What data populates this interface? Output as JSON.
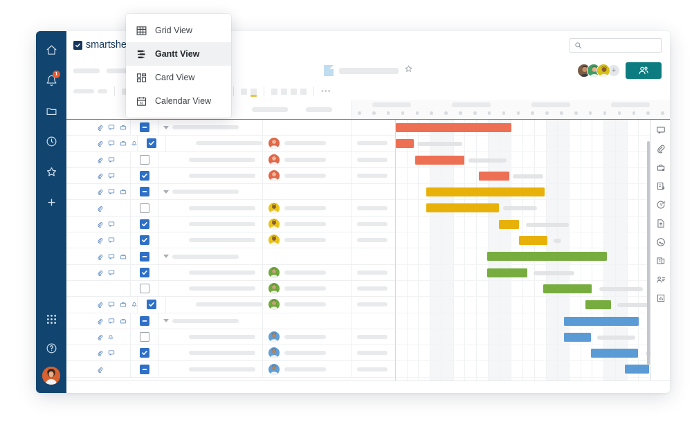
{
  "app": {
    "name": "smartsheet",
    "logo_icon": "checkbox-mark-icon"
  },
  "left_rail": {
    "items": [
      {
        "icon": "home-icon",
        "name": "home",
        "badge": null
      },
      {
        "icon": "bell-icon",
        "name": "notifications",
        "badge": "1"
      },
      {
        "icon": "folder-icon",
        "name": "browse",
        "badge": null
      },
      {
        "icon": "clock-icon",
        "name": "recents",
        "badge": null
      },
      {
        "icon": "star-icon",
        "name": "favorites",
        "badge": null
      },
      {
        "icon": "plus-icon",
        "name": "create",
        "badge": null
      }
    ],
    "bottom_items": [
      {
        "icon": "grid-apps-icon",
        "name": "apps-launcher"
      },
      {
        "icon": "help-icon",
        "name": "help"
      },
      {
        "icon": "user-avatar",
        "name": "account-avatar"
      }
    ]
  },
  "header": {
    "search_placeholder": "",
    "search_value": "",
    "search_icon": "search-icon",
    "share_icon": "share-people-icon",
    "share_label": "",
    "avatar_overflow_label": "+",
    "avatars": [
      {
        "name": "collaborator-1",
        "color": "#7a5c45"
      },
      {
        "name": "collaborator-2",
        "color": "#3f9e63"
      },
      {
        "name": "collaborator-3",
        "color": "#d8c117"
      }
    ]
  },
  "title_row": {
    "sheet_icon": "sheet-document-icon",
    "sheet_title": "",
    "favorite_icon": "star-outline-icon"
  },
  "toolbar": {
    "overflow_icon": "more-horizontal-icon",
    "highlight_colors": {
      "cyan": "#35c5d8",
      "black": "#1d1d1d",
      "yellow": "#e8c548"
    }
  },
  "view_menu": {
    "items": [
      {
        "label": "Grid View",
        "icon": "grid-view-icon",
        "active": false
      },
      {
        "label": "Gantt View",
        "icon": "gantt-view-icon",
        "active": true
      },
      {
        "label": "Card View",
        "icon": "card-view-icon",
        "active": false
      },
      {
        "label": "Calendar View",
        "icon": "calendar-view-icon",
        "active": false
      }
    ]
  },
  "right_rail": {
    "items": [
      {
        "icon": "conversations-icon",
        "name": "conversations"
      },
      {
        "icon": "attachments-icon",
        "name": "attachments"
      },
      {
        "icon": "proofs-icon",
        "name": "proofs"
      },
      {
        "icon": "update-request-icon",
        "name": "update-requests"
      },
      {
        "icon": "activity-log-icon",
        "name": "activity-log"
      },
      {
        "icon": "publish-icon",
        "name": "publish"
      },
      {
        "icon": "automation-icon",
        "name": "automation"
      },
      {
        "icon": "summary-icon",
        "name": "sheet-summary"
      },
      {
        "icon": "contacts-icon",
        "name": "contacts"
      },
      {
        "icon": "reports-icon",
        "name": "reports"
      }
    ]
  },
  "chart_data": {
    "type": "gantt",
    "title": "",
    "colors": {
      "group_1": "#ed7054",
      "group_2": "#e8b109",
      "group_3": "#77ad3f",
      "group_4": "#5b9bd5",
      "label_placeholder": "#e2e4e6"
    },
    "timeline": {
      "columns": 22,
      "shaded_columns": [
        3,
        4,
        8,
        9,
        13,
        14,
        18,
        19
      ],
      "month_labels": [
        "",
        "",
        "",
        ""
      ],
      "day_tick_count": 22
    },
    "rows": [
      {
        "level": 0,
        "checkbox": "dash",
        "icons": [
          "attachment",
          "comment",
          "lock"
        ],
        "assignee": null,
        "bar": {
          "start": 0.0,
          "width": 45.5,
          "color": "group_1"
        },
        "label_bar": null
      },
      {
        "level": 1,
        "checkbox": "checked",
        "icons": [
          "attachment",
          "comment",
          "lock",
          "reminder"
        ],
        "assignee": "red",
        "bar": {
          "start": 0.0,
          "width": 7.0,
          "color": "group_1"
        },
        "label_bar": {
          "start": 8.5,
          "width": 17.5
        }
      },
      {
        "level": 1,
        "checkbox": "empty",
        "icons": [
          "attachment",
          "comment"
        ],
        "assignee": "red",
        "bar": {
          "start": 7.6,
          "width": 19.3,
          "color": "group_1"
        },
        "label_bar": {
          "start": 28.5,
          "width": 15.0
        }
      },
      {
        "level": 1,
        "checkbox": "checked",
        "icons": [
          "attachment",
          "comment"
        ],
        "assignee": "red",
        "bar": {
          "start": 32.5,
          "width": 12.0,
          "color": "group_1"
        },
        "label_bar": {
          "start": 46.0,
          "width": 12.0
        }
      },
      {
        "level": 0,
        "checkbox": "dash",
        "icons": [
          "attachment",
          "comment",
          "lock"
        ],
        "assignee": null,
        "bar": {
          "start": 12.0,
          "width": 46.5,
          "color": "group_2"
        },
        "label_bar": null
      },
      {
        "level": 1,
        "checkbox": "empty",
        "icons": [
          "attachment"
        ],
        "assignee": "yellow",
        "bar": {
          "start": 12.0,
          "width": 28.5,
          "color": "group_2"
        },
        "label_bar": {
          "start": 42.0,
          "width": 13.5
        }
      },
      {
        "level": 1,
        "checkbox": "checked",
        "icons": [
          "attachment",
          "comment"
        ],
        "assignee": "yellow",
        "bar": {
          "start": 40.5,
          "width": 8.0,
          "color": "group_2"
        },
        "label_bar": {
          "start": 51.0,
          "width": 17.0
        }
      },
      {
        "level": 1,
        "checkbox": "checked",
        "icons": [
          "attachment",
          "comment"
        ],
        "assignee": "yellow",
        "bar": {
          "start": 48.5,
          "width": 11.0,
          "color": "group_2"
        },
        "label_bar": {
          "start": 62.0,
          "width": 3.0
        }
      },
      {
        "level": 0,
        "checkbox": "dash",
        "icons": [
          "attachment",
          "comment",
          "lock"
        ],
        "assignee": null,
        "bar": {
          "start": 36.0,
          "width": 47.0,
          "color": "group_3"
        },
        "label_bar": null
      },
      {
        "level": 1,
        "checkbox": "checked",
        "icons": [
          "attachment",
          "comment"
        ],
        "assignee": "green",
        "bar": {
          "start": 36.0,
          "width": 15.5,
          "color": "group_3"
        },
        "label_bar": {
          "start": 54.0,
          "width": 16.0
        }
      },
      {
        "level": 1,
        "checkbox": "empty",
        "icons": [],
        "assignee": "green",
        "bar": {
          "start": 58.0,
          "width": 19.0,
          "color": "group_3"
        },
        "label_bar": {
          "start": 80.0,
          "width": 17.0
        }
      },
      {
        "level": 1,
        "checkbox": "checked",
        "icons": [
          "attachment",
          "comment",
          "lock",
          "reminder"
        ],
        "assignee": "green",
        "bar": {
          "start": 74.5,
          "width": 10.0,
          "color": "group_3"
        },
        "label_bar": {
          "start": 87.0,
          "width": 13.0
        }
      },
      {
        "level": 0,
        "checkbox": "dash",
        "icons": [
          "attachment",
          "comment",
          "lock"
        ],
        "assignee": null,
        "bar": {
          "start": 66.0,
          "width": 29.5,
          "color": "group_4"
        },
        "label_bar": null
      },
      {
        "level": 1,
        "checkbox": "empty",
        "icons": [
          "attachment",
          "reminder"
        ],
        "assignee": "blue",
        "bar": {
          "start": 66.0,
          "width": 10.5,
          "color": "group_4"
        },
        "label_bar": {
          "start": 79.0,
          "width": 15.0
        }
      },
      {
        "level": 1,
        "checkbox": "checked",
        "icons": [
          "attachment",
          "comment"
        ],
        "assignee": "blue",
        "bar": {
          "start": 76.5,
          "width": 18.5,
          "color": "group_4"
        },
        "label_bar": {
          "start": 98.0,
          "width": 9.0
        }
      },
      {
        "level": 1,
        "checkbox": "dash",
        "icons": [
          "attachment"
        ],
        "assignee": "blue",
        "bar": {
          "start": 90.0,
          "width": 9.5,
          "color": "group_4"
        },
        "label_bar": null
      }
    ]
  }
}
